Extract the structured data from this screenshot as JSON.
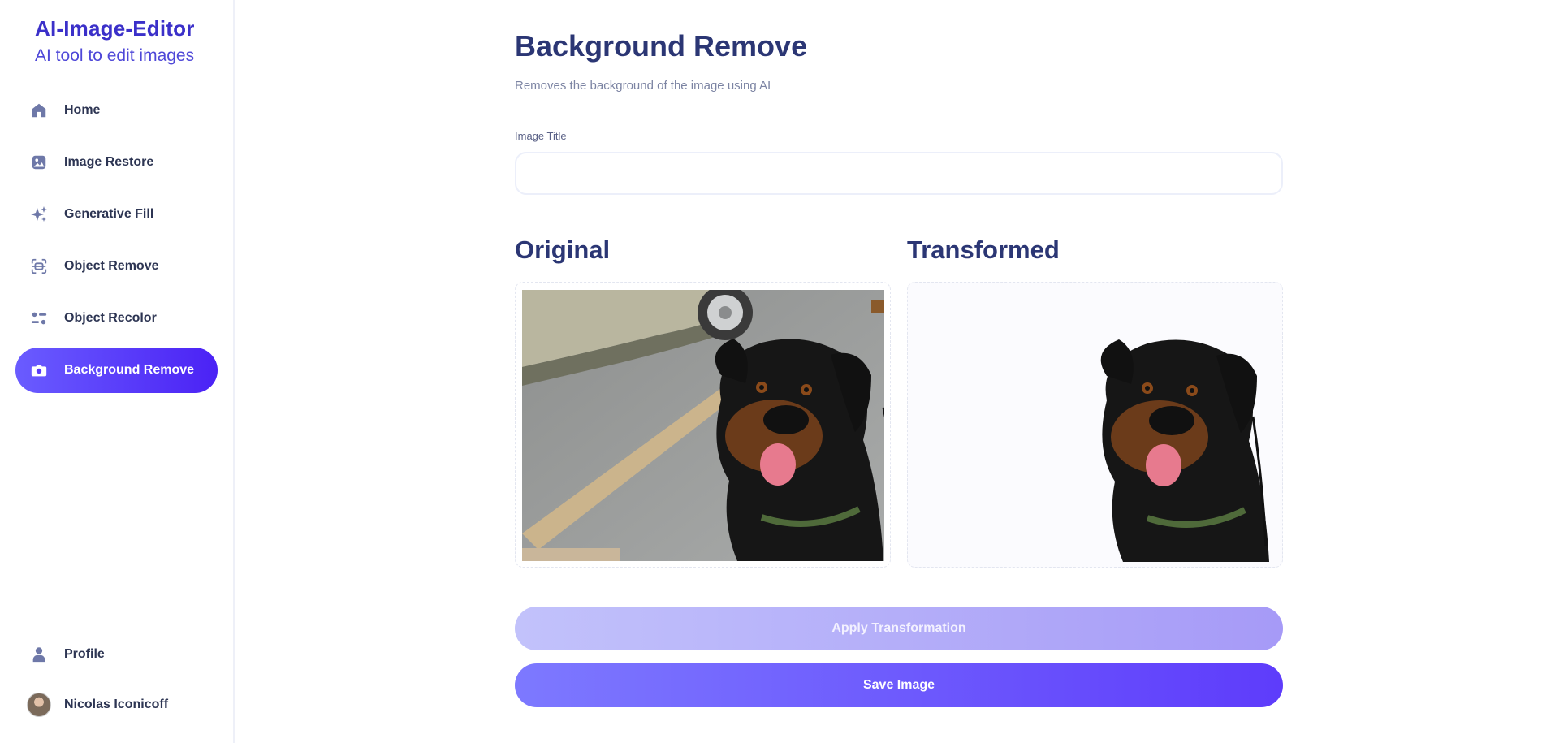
{
  "brand": {
    "title": "AI-Image-Editor",
    "subtitle": "AI tool to edit images"
  },
  "sidebar": {
    "items": [
      {
        "label": "Home",
        "icon": "home-icon"
      },
      {
        "label": "Image Restore",
        "icon": "image-icon"
      },
      {
        "label": "Generative Fill",
        "icon": "sparkles-icon"
      },
      {
        "label": "Object Remove",
        "icon": "scan-icon"
      },
      {
        "label": "Object Recolor",
        "icon": "filter-icon"
      },
      {
        "label": "Background Remove",
        "icon": "camera-icon",
        "active": true
      }
    ],
    "bottom": {
      "profile_label": "Profile",
      "user_name": "Nicolas Iconicoff"
    }
  },
  "main": {
    "title": "Background Remove",
    "subtitle": "Removes the background of the image using AI",
    "image_title_label": "Image Title",
    "image_title_value": "",
    "original_heading": "Original",
    "transformed_heading": "Transformed",
    "apply_button": "Apply Transformation",
    "save_button": "Save Image"
  },
  "colors": {
    "brand": "#3b30c9",
    "heading": "#2b3674",
    "active_gradient_start": "#6a5cff",
    "active_gradient_end": "#4b22f5",
    "icon": "#6e78a8"
  }
}
